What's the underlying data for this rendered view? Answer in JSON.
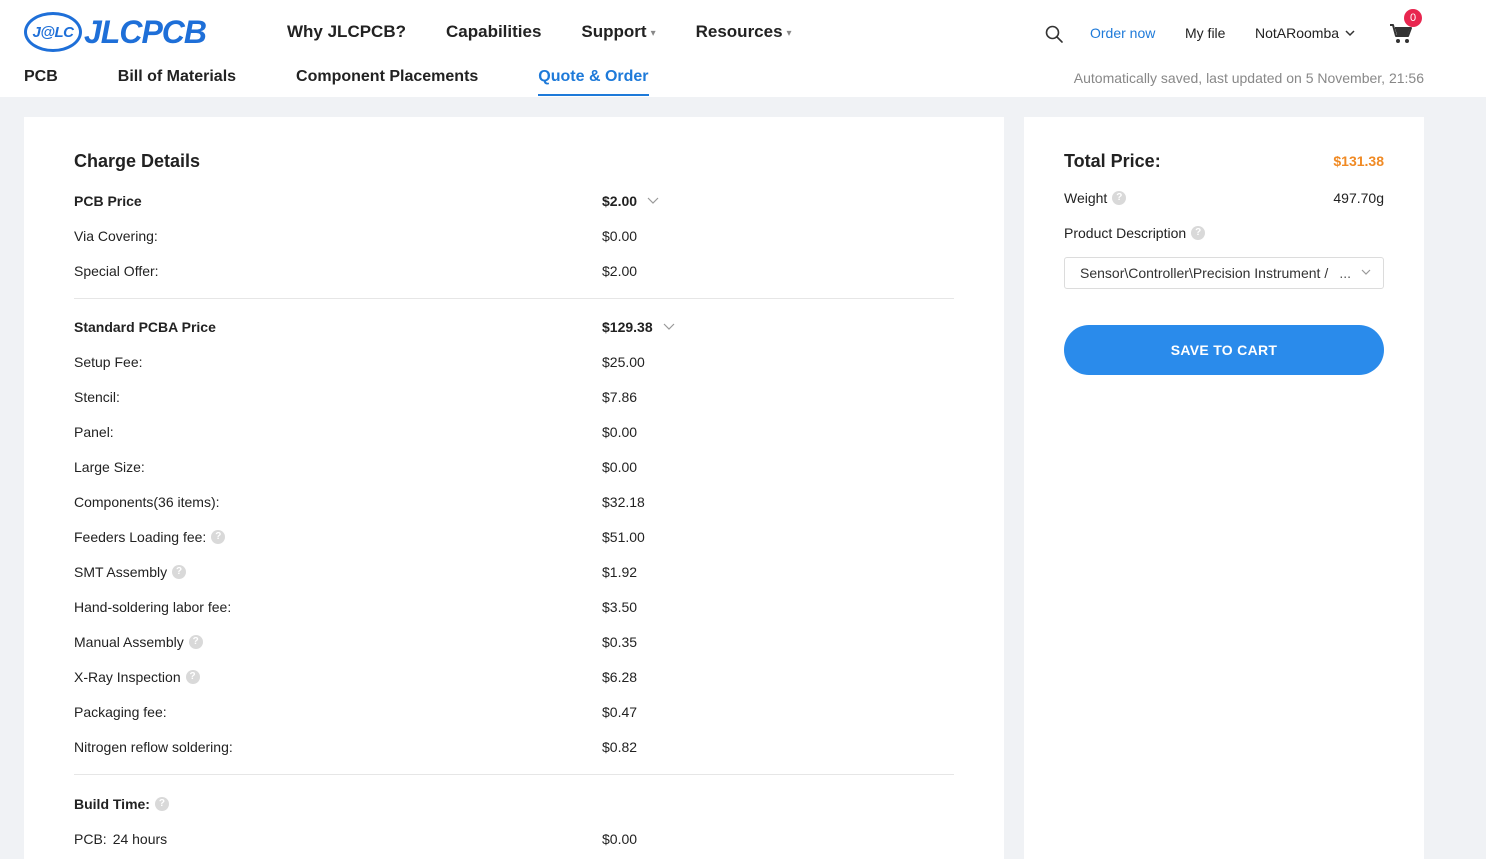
{
  "brand": {
    "logo_mark": "J@LC",
    "logo_text": "JLCPCB"
  },
  "main_nav": [
    {
      "label": "Why JLCPCB?",
      "caret": false
    },
    {
      "label": "Capabilities",
      "caret": false
    },
    {
      "label": "Support",
      "caret": true
    },
    {
      "label": "Resources",
      "caret": true
    }
  ],
  "right_nav": {
    "search_icon": "search-icon",
    "order_now": "Order now",
    "my_file": "My file",
    "username": "NotARoomba",
    "cart_count": "0",
    "accent": "#1e7ad9",
    "badge_color": "#e8264f"
  },
  "tabs": [
    {
      "label": "PCB",
      "active": false
    },
    {
      "label": "Bill of Materials",
      "active": false
    },
    {
      "label": "Component Placements",
      "active": false
    },
    {
      "label": "Quote & Order",
      "active": true
    }
  ],
  "autosave": "Automatically saved, last updated on 5 November, 21:56",
  "charge_details": {
    "title": "Charge Details",
    "pcb": {
      "label": "PCB Price",
      "value": "$2.00",
      "items": [
        {
          "label": "Via Covering:",
          "value": "$0.00"
        },
        {
          "label": "Special Offer:",
          "value": "$2.00"
        }
      ]
    },
    "pcba": {
      "label": "Standard PCBA Price",
      "value": "$129.38",
      "items": [
        {
          "label": "Setup Fee:",
          "value": "$25.00",
          "help": false
        },
        {
          "label": "Stencil:",
          "value": "$7.86",
          "help": false
        },
        {
          "label": "Panel:",
          "value": "$0.00",
          "help": false
        },
        {
          "label": "Large Size:",
          "value": "$0.00",
          "help": false
        },
        {
          "label": "Components(36 items):",
          "value": "$32.18",
          "help": false
        },
        {
          "label": "Feeders Loading fee:",
          "value": "$51.00",
          "help": true
        },
        {
          "label": "SMT Assembly",
          "value": "$1.92",
          "help": true
        },
        {
          "label": "Hand-soldering labor fee:",
          "value": "$3.50",
          "help": false
        },
        {
          "label": "Manual Assembly",
          "value": "$0.35",
          "help": true
        },
        {
          "label": "X-Ray Inspection",
          "value": "$6.28",
          "help": true
        },
        {
          "label": "Packaging fee:",
          "value": "$0.47",
          "help": false
        },
        {
          "label": "Nitrogen reflow soldering:",
          "value": "$0.82",
          "help": false
        }
      ]
    },
    "build_time": {
      "label": "Build Time:",
      "pcb_label": "PCB:",
      "pcb_time": "24 hours",
      "pcb_value": "$0.00"
    }
  },
  "summary": {
    "total_label": "Total Price:",
    "total_value": "$131.38",
    "total_color": "#f08a24",
    "weight_label": "Weight",
    "weight_value": "497.70g",
    "desc_label": "Product Description",
    "desc_value": "Sensor\\Controller\\Precision Instrument /",
    "desc_ellipsis": "...",
    "save_button": "SAVE TO CART",
    "button_color": "#2a8beb"
  }
}
